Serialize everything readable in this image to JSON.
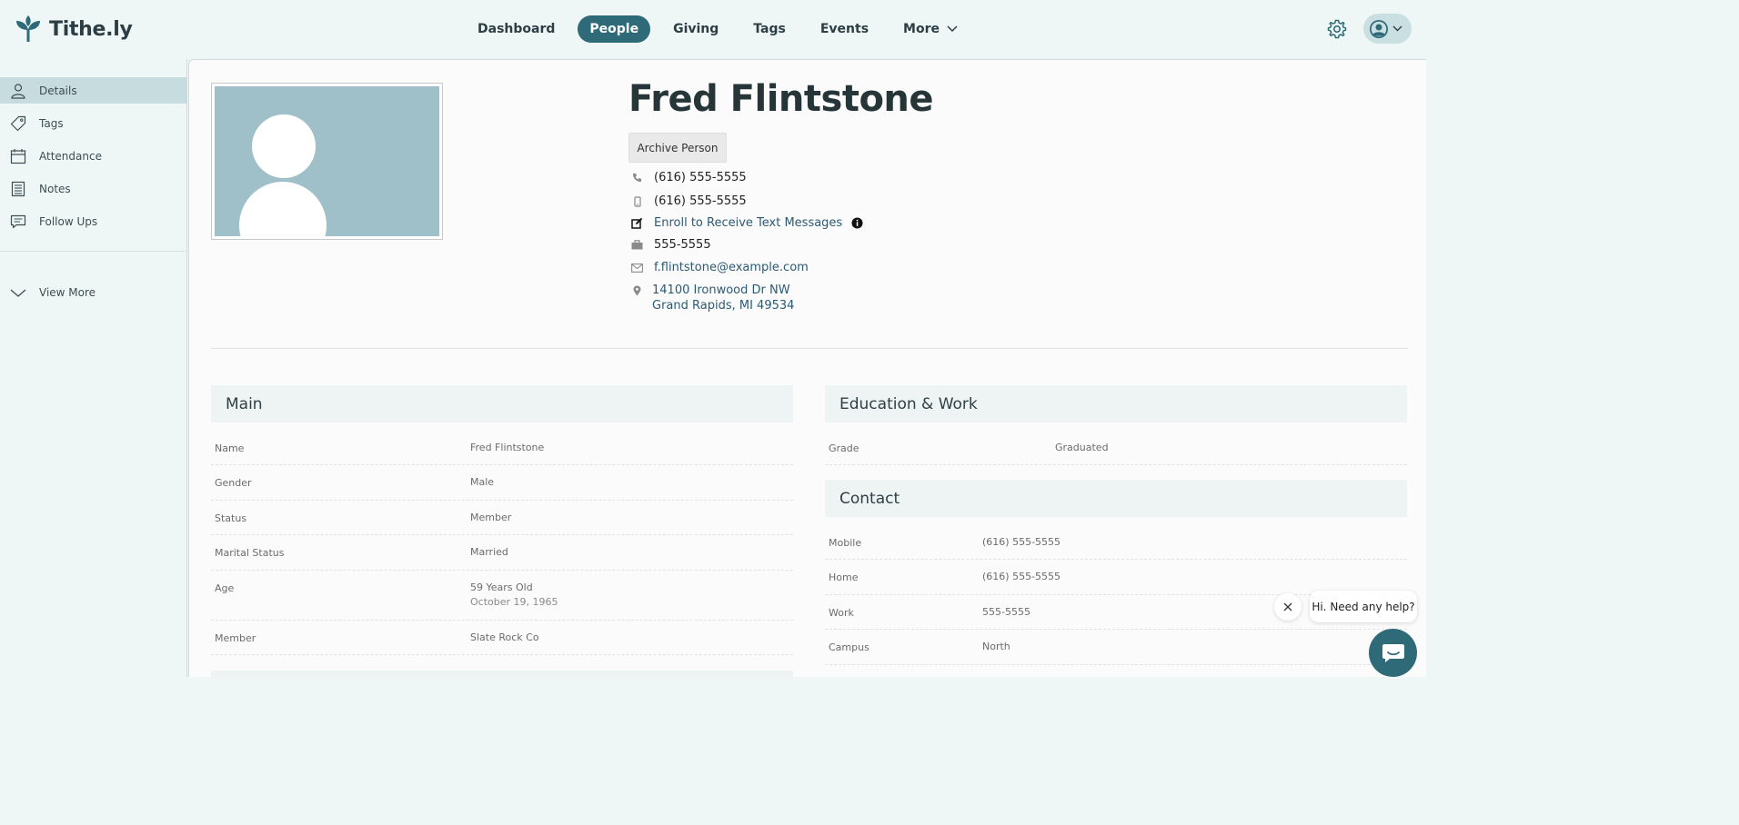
{
  "brand": {
    "name": "Tithe.ly",
    "color": "#2e6a78"
  },
  "nav": {
    "items": [
      {
        "label": "Dashboard"
      },
      {
        "label": "People",
        "active": true
      },
      {
        "label": "Giving"
      },
      {
        "label": "Tags"
      },
      {
        "label": "Events"
      },
      {
        "label": "More"
      }
    ]
  },
  "sidebar": {
    "items": [
      {
        "label": "Details",
        "icon": "user-icon",
        "active": true
      },
      {
        "label": "Tags",
        "icon": "tag-icon"
      },
      {
        "label": "Attendance",
        "icon": "calendar-icon"
      },
      {
        "label": "Notes",
        "icon": "notes-icon"
      },
      {
        "label": "Follow Ups",
        "icon": "chat-icon"
      }
    ],
    "view_more": "View More"
  },
  "person": {
    "name": "Fred Flintstone",
    "archive_label": "Archive Person",
    "home_phone": "(616) 555-5555",
    "mobile_phone": "(616) 555-5555",
    "enroll_label": "Enroll to Receive Text Messages",
    "work_phone": "555-5555",
    "email": "f.flintstone@example.com",
    "address_line1": "14100 Ironwood Dr NW",
    "address_line2": "Grand Rapids, MI 49534"
  },
  "main_section": {
    "title": "Main",
    "rows": [
      {
        "key": "Name",
        "value": "Fred Flintstone"
      },
      {
        "key": "Gender",
        "value": "Male"
      },
      {
        "key": "Status",
        "value": "Member"
      },
      {
        "key": "Marital Status",
        "value": "Married"
      },
      {
        "key": "Age",
        "value": "59 Years Old",
        "sub": "October 19, 1965"
      },
      {
        "key": "Member",
        "value": "Slate Rock Co"
      }
    ]
  },
  "education_section": {
    "title": "Education & Work",
    "rows": [
      {
        "key": "Grade",
        "value": "Graduated"
      }
    ]
  },
  "contact_section": {
    "title": "Contact",
    "rows": [
      {
        "key": "Mobile",
        "value": "(616) 555-5555"
      },
      {
        "key": "Home",
        "value": "(616) 555-5555"
      },
      {
        "key": "Work",
        "value": "555-5555"
      },
      {
        "key": "Campus",
        "value": "North"
      }
    ]
  },
  "chat": {
    "prompt": "Hi. Need any help?"
  }
}
